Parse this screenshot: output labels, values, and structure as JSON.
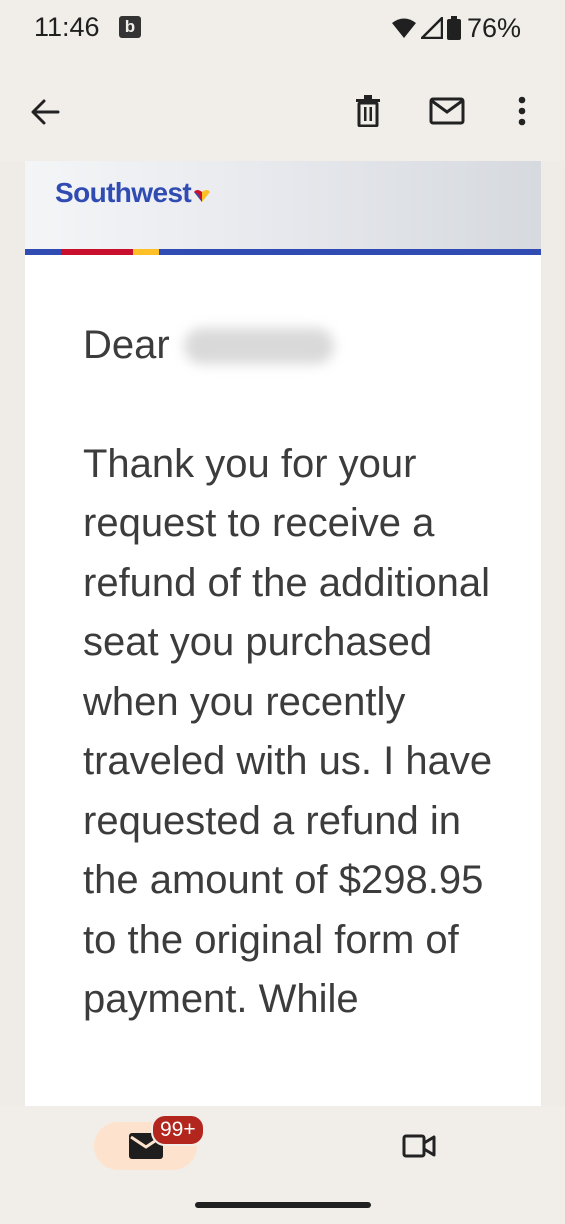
{
  "status_bar": {
    "time": "11:46",
    "app_indicator": "b",
    "battery": "76%",
    "icons": [
      "wifi-icon",
      "signal-icon",
      "battery-icon"
    ]
  },
  "app_bar": {
    "icons": [
      "back-arrow-icon",
      "trash-icon",
      "mark-unread-icon",
      "more-vert-icon"
    ]
  },
  "email": {
    "brand": "Southwest",
    "brand_colors": {
      "blue": "#304cb2",
      "red": "#c8102e",
      "yellow": "#ffbf27"
    },
    "greeting": "Dear",
    "body": "Thank you for your request to receive a refund of the additional seat you purchased when you recently traveled with us. I have requested a refund in the amount of $298.95 to the original form of payment. While"
  },
  "bottom_nav": {
    "mail_badge": "99+",
    "icons": [
      "mail-icon",
      "video-camera-icon"
    ]
  }
}
